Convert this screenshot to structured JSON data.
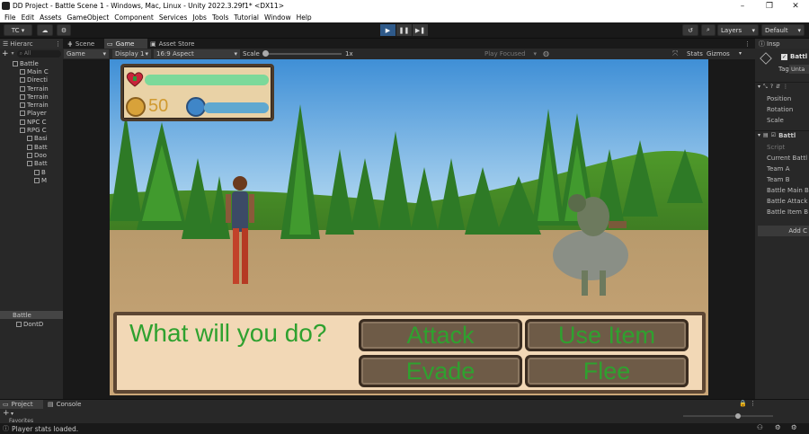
{
  "window": {
    "title": "DD Project - Battle Scene 1 - Windows, Mac, Linux - Unity 2022.3.29f1* <DX11>",
    "controls": [
      "–",
      "❐",
      "✕"
    ]
  },
  "menu": [
    "File",
    "Edit",
    "Assets",
    "GameObject",
    "Component",
    "Services",
    "Jobs",
    "Tools",
    "Tutorial",
    "Window",
    "Help"
  ],
  "toolbar": {
    "account": "TC",
    "layers": "Layers",
    "layout": "Default"
  },
  "hierarchy": {
    "tab": "Hierarc",
    "rows": [
      {
        "label": "Battle",
        "indent": 0
      },
      {
        "label": "Main C",
        "indent": 1
      },
      {
        "label": "Directi",
        "indent": 1
      },
      {
        "label": "Terrain",
        "indent": 1
      },
      {
        "label": "Terrain",
        "indent": 1
      },
      {
        "label": "Terrain",
        "indent": 1
      },
      {
        "label": "Player",
        "indent": 1
      },
      {
        "label": "NPC C",
        "indent": 1
      },
      {
        "label": "RPG C",
        "indent": 1
      },
      {
        "label": "Basi",
        "indent": 2
      },
      {
        "label": "Batt",
        "indent": 2
      },
      {
        "label": "Doo",
        "indent": 2
      },
      {
        "label": "Batt",
        "indent": 2
      },
      {
        "label": "B",
        "indent": 3
      },
      {
        "label": "M",
        "indent": 3
      }
    ],
    "bottom_rows": [
      "Battle",
      "DontD"
    ]
  },
  "scene_tabs": [
    "Scene",
    "Game",
    "Asset Store"
  ],
  "gamebar": {
    "mode": "Game",
    "display": "Display 1",
    "aspect": "16:9 Aspect",
    "scale_label": "Scale",
    "scale_value": "1x",
    "play_focused": "Play Focused",
    "stats": "Stats",
    "gizmos": "Gizmos"
  },
  "hud": {
    "gold": "50",
    "hp_fraction": 1.0,
    "mp_fraction": 1.0
  },
  "dialog": {
    "prompt": "What will you do?",
    "buttons": [
      "Attack",
      "Use Item",
      "Evade",
      "Flee"
    ]
  },
  "inspector": {
    "tab": "Insp",
    "object_name": "Battl",
    "tag_label": "Tag",
    "tag_value": "Unta",
    "transform_rows": [
      "Position",
      "Rotation",
      "Scale"
    ],
    "script_rows": [
      "Script",
      "Current Battl",
      "Team A",
      "Team B",
      "Battle Main B",
      "Battle Attack",
      "Battle Item B"
    ],
    "add_component": "Add C"
  },
  "project": {
    "tabs": [
      "Project",
      "Console"
    ],
    "favorites": "Favorites"
  },
  "status": {
    "message": "Player stats loaded."
  },
  "colors": {
    "play_active": "#2f5a8a",
    "dialog_text": "#2fa12f",
    "hp_bar": "#7cd99a",
    "mp_bar": "#5fa8d0"
  }
}
